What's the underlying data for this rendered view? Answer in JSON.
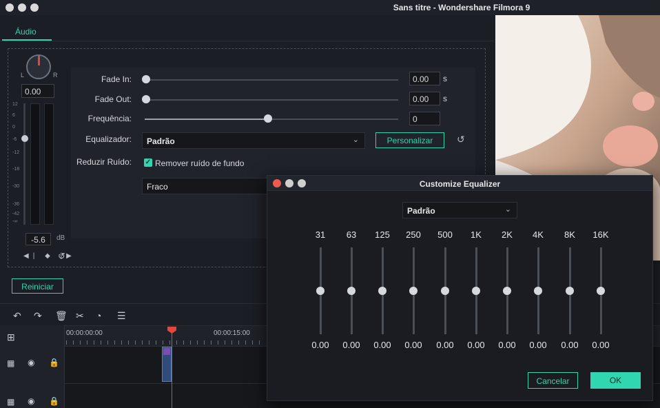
{
  "window": {
    "title": "Sans titre - Wondershare Filmora 9"
  },
  "tabs": {
    "audio": "Áudio"
  },
  "pan": {
    "left": "L",
    "right": "R",
    "value": "0.00"
  },
  "volume": {
    "scale": [
      "12",
      "6",
      "0",
      "-6",
      "-12",
      "-18",
      "-30",
      "-36",
      "-42",
      "-∞"
    ],
    "value": "-5.6",
    "unit": "dB",
    "mini_controls": "◀| ◆ |▶"
  },
  "settings": {
    "fade_in": {
      "label": "Fade In:",
      "value": "0.00",
      "unit": "s",
      "level": 0
    },
    "fade_out": {
      "label": "Fade Out:",
      "value": "0.00",
      "unit": "s",
      "level": 0
    },
    "frequency": {
      "label": "Frequência:",
      "value": "0",
      "level": 0.48
    },
    "equalizer": {
      "label": "Equalizador:",
      "selected": "Padrão",
      "customize_label": "Personalizar"
    },
    "noise": {
      "label": "Reduzir Ruído:",
      "checkbox_label": "Remover ruído de fundo",
      "checked": true,
      "level_selected": "Fraco"
    }
  },
  "reset_label": "Reiniciar",
  "timeline": {
    "times": [
      "00:00:00:00",
      "00:00:15:00"
    ]
  },
  "dialog": {
    "title": "Customize Equalizer",
    "preset": "Padrão",
    "bands": [
      {
        "freq": "31",
        "value": "0.00"
      },
      {
        "freq": "63",
        "value": "0.00"
      },
      {
        "freq": "125",
        "value": "0.00"
      },
      {
        "freq": "250",
        "value": "0.00"
      },
      {
        "freq": "500",
        "value": "0.00"
      },
      {
        "freq": "1K",
        "value": "0.00"
      },
      {
        "freq": "2K",
        "value": "0.00"
      },
      {
        "freq": "4K",
        "value": "0.00"
      },
      {
        "freq": "8K",
        "value": "0.00"
      },
      {
        "freq": "16K",
        "value": "0.00"
      }
    ],
    "cancel_label": "Cancelar",
    "ok_label": "OK"
  },
  "colors": {
    "accent": "#2fd6b0",
    "close_red": "#ed5a50",
    "playhead": "#e5463c"
  }
}
